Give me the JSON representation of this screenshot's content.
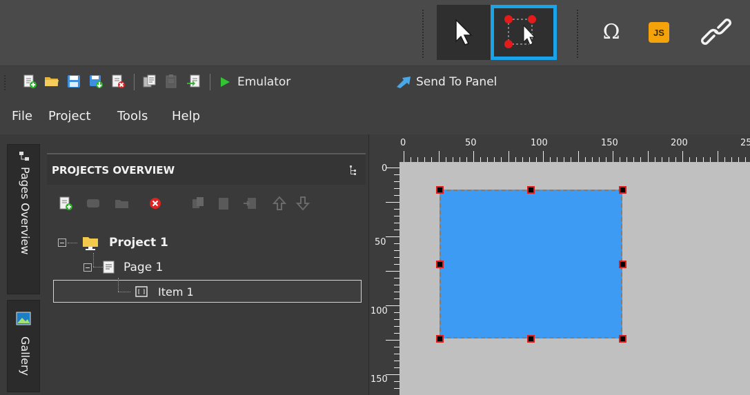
{
  "modebar": {
    "select_mode_icon": "arrow-cursor-icon",
    "multiselect_mode_icon": "multi-select-cursor-icon",
    "omega_label": "Ω",
    "js_label": "JS",
    "link_icon": "chain-link-icon"
  },
  "toolbar": {
    "buttons": [
      "new-project-icon",
      "open-folder-icon",
      "save-icon",
      "save-all-icon",
      "close-project-icon",
      "copy-page-icon",
      "paste-page-icon",
      "import-page-icon"
    ],
    "emulator_label": "Emulator",
    "send_label": "Send To Panel"
  },
  "menu": {
    "items": [
      "File",
      "Project",
      "Tools",
      "Help"
    ]
  },
  "side_tabs": {
    "pages_overview": "Pages Overview",
    "gallery": "Gallery"
  },
  "projects": {
    "title": "PROJECTS OVERVIEW",
    "tree": {
      "project": "Project 1",
      "page": "Page 1",
      "item": "Item 1"
    }
  },
  "ruler": {
    "x_labels": [
      "0",
      "50",
      "100",
      "150",
      "200",
      "25"
    ],
    "y_labels": [
      "0",
      "50",
      "100",
      "150"
    ]
  },
  "colors": {
    "accent": "#1aa3e8",
    "widget_fill": "#3d9bf4",
    "handle": "#e01b1b",
    "canvas": "#c0c0c0"
  }
}
